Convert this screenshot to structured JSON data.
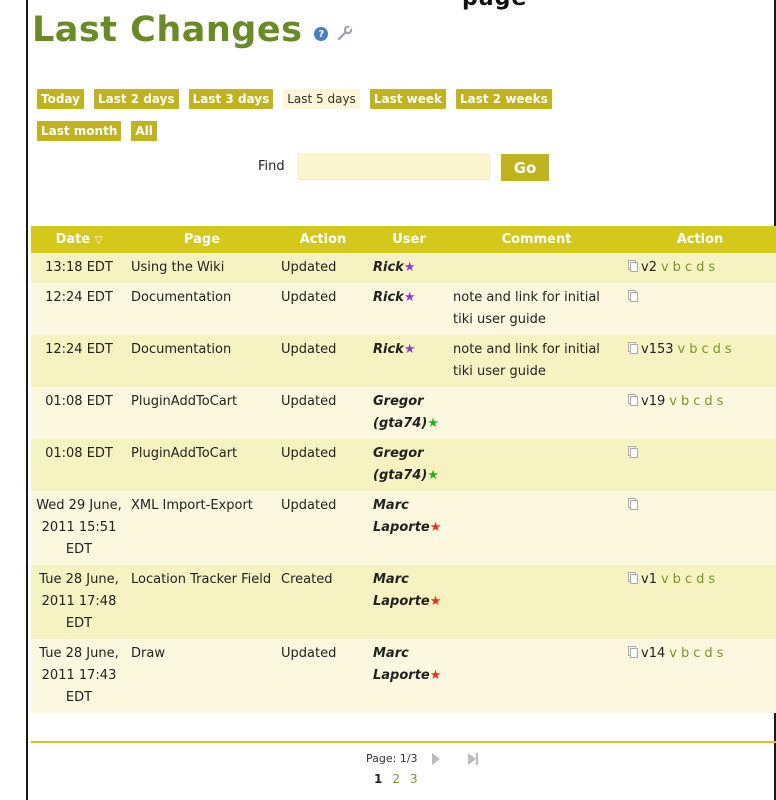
{
  "top_partial_text": "page",
  "title": "Last Changes",
  "filters": {
    "row1": [
      "Today",
      "Last 2 days",
      "Last 3 days",
      "Last 5 days",
      "Last week",
      "Last 2 weeks"
    ],
    "row2": [
      "Last month",
      "All"
    ],
    "active": "Last 5 days"
  },
  "find": {
    "label": "Find",
    "value": "",
    "button": "Go"
  },
  "table": {
    "headers": [
      "Date",
      "Page",
      "Action",
      "User",
      "Comment",
      "Action"
    ],
    "rows": [
      {
        "date": "13:18 EDT",
        "page": "Using the Wiki",
        "action": "Updated",
        "user": "Rick",
        "star": "purple",
        "comment": "",
        "version": "v2",
        "links": [
          "v",
          "b",
          "c",
          "d",
          "s"
        ]
      },
      {
        "date": "12:24 EDT",
        "page": "Documentation",
        "action": "Updated",
        "user": "Rick",
        "star": "purple",
        "comment": "note and link for initial tiki user guide",
        "version": "",
        "links": []
      },
      {
        "date": "12:24 EDT",
        "page": "Documentation",
        "action": "Updated",
        "user": "Rick",
        "star": "purple",
        "comment": "note and link for initial tiki user guide",
        "version": "v153",
        "links": [
          "v",
          "b",
          "c",
          "d",
          "s"
        ]
      },
      {
        "date": "01:08 EDT",
        "page": "PluginAddToCart",
        "action": "Updated",
        "user": "Gregor (gta74)",
        "star": "green",
        "comment": "",
        "version": "v19",
        "links": [
          "v",
          "b",
          "c",
          "d",
          "s"
        ]
      },
      {
        "date": "01:08 EDT",
        "page": "PluginAddToCart",
        "action": "Updated",
        "user": "Gregor (gta74)",
        "star": "green",
        "comment": "",
        "version": "",
        "links": []
      },
      {
        "date": "Wed 29 June, 2011 15:51 EDT",
        "page": "XML Import-Export",
        "action": "Updated",
        "user": "Marc Laporte",
        "star": "red",
        "comment": "",
        "version": "",
        "links": []
      },
      {
        "date": "Tue 28 June, 2011 17:48 EDT",
        "page": "Location Tracker Field",
        "action": "Created",
        "user": "Marc Laporte",
        "star": "red",
        "comment": "",
        "version": "v1",
        "links": [
          "v",
          "b",
          "c",
          "d",
          "s"
        ]
      },
      {
        "date": "Tue 28 June, 2011 17:43 EDT",
        "page": "Draw",
        "action": "Updated",
        "user": "Marc Laporte",
        "star": "red",
        "comment": "",
        "version": "v14",
        "links": [
          "v",
          "b",
          "c",
          "d",
          "s"
        ]
      }
    ]
  },
  "pagination": {
    "label": "Page: 1/3",
    "pages": [
      "1",
      "2",
      "3"
    ],
    "current": "1"
  },
  "colors": {
    "title": "#6a8a26",
    "accent": "#bfb31e",
    "header": "#d4c81a",
    "row_odd": "#f7f2c1",
    "row_even": "#fbf8df"
  }
}
